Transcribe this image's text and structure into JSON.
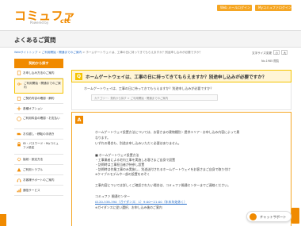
{
  "header": {
    "logo": "コミュファ",
    "logo_sub": "Powered by",
    "logo_brand": "ctc",
    "web_mail_login": "Web メールログイン",
    "mypage_login": "Myコミュファログイン"
  },
  "page": {
    "title": "よくあるご質問"
  },
  "breadcrumb": {
    "home": "Webサイトトップ",
    "sep": ">",
    "section": "ご利用開始・開通までのご案内",
    "current": "ホームゲートウェイは、工事の日に持ってきてもらえますか？別途申し込みが必要ですか？"
  },
  "font_size": {
    "label": "文字サイズ変更",
    "small": "小",
    "large": "大"
  },
  "sidebar": {
    "head": "契約から探す",
    "items": [
      {
        "label": "お申し込み方法のご案内",
        "icon": "document-icon"
      },
      {
        "label": "ご利用開始・開通までのご案内",
        "icon": "key-icon"
      },
      {
        "label": "ご契約内容の確認・解約",
        "icon": "clipboard-icon"
      },
      {
        "label": "各種オプション",
        "icon": "plus-icon"
      },
      {
        "label": "ご利用料金の確認・お支払い",
        "icon": "yen-icon"
      },
      {
        "label": "お引越し・移転の手続き",
        "icon": "truck-icon"
      },
      {
        "label": "ID・パスワード・Myコミュファ設定",
        "icon": "lock-icon"
      },
      {
        "label": "接続・設定方法",
        "icon": "gear-icon"
      },
      {
        "label": "ご利用トラブル",
        "icon": "warning-icon"
      },
      {
        "label": "お客様サポートのご案内",
        "icon": "headset-icon"
      },
      {
        "label": "通信サービス",
        "icon": "signal-icon"
      }
    ]
  },
  "views": "No.1985  閲覧",
  "question": {
    "mark": "Q",
    "title": "ホームゲートウェイは、工事の日に持ってきてもらえますか？別途申し込みが必要ですか？",
    "detail": "ホームゲートウェイは、工事の日に持ってきてもらえますか？別途申し込みが必要ですか？",
    "category": "カテゴリー：契約から探す > ご利用開始・開通までのご案内"
  },
  "answer": {
    "mark": "A",
    "lines": [
      "ホームゲートウェイ設置方法については、お客さまの建物種別・提供エリア・お申し込み内容によって異",
      "なります。",
      "いずれの場合も、別途お申し込みいただく必要はありません。",
      "",
      "■ ホームゲートウェイ設置方法",
      "・工事業者による宅内工事を実施しお客さまご自身で設置",
      "・訪問時は工事担当者が持参し設置",
      "・訪問時は作業工事のみ実施し、別途送付されるホームゲートウェイをお客さまご自身で取り付け",
      "  ※ケイブルモデムや一部の設置をのぞく",
      "",
      "工事内容については詳しくご確認されたい場合は、コミュファ開通センターまでご連絡ください。",
      "",
      "コミュファ 開通センター",
      "0120-538-390（ガイダンス：1）9:00〜21:00（年末年始休く）",
      "※ガイダンスに従い選択、お申し込み後のご案内"
    ],
    "phone_link_index": 13
  },
  "floating": {
    "chat": "チャットサポート"
  },
  "colors": {
    "brand_orange": "#f08a00",
    "accent_yellow": "#f5c400",
    "link_blue": "#2a6fc9"
  }
}
